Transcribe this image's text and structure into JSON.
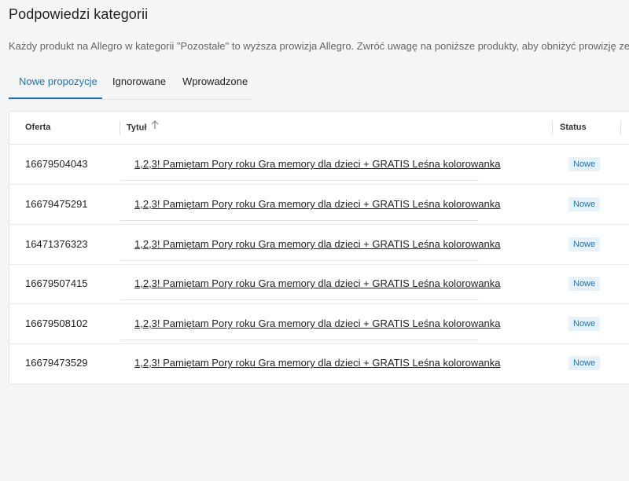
{
  "page": {
    "title": "Podpowiedzi kategorii",
    "description": "Każdy produkt na Allegro w kategorii \"Pozostałe\" to wyższa prowizja Allegro. Zwróć uwagę na poniższe produkty, aby obniżyć prowizję ze sprzedaży"
  },
  "tabs": [
    {
      "label": "Nowe propozycje",
      "active": true
    },
    {
      "label": "Ignorowane",
      "active": false
    },
    {
      "label": "Wprowadzone",
      "active": false
    }
  ],
  "table": {
    "headers": {
      "offer": "Oferta",
      "title": "Tytuł",
      "status": "Status"
    },
    "sort_icon": "arrow-up-icon",
    "rows": [
      {
        "offer": "16679504043",
        "title": "1,2,3! Pamiętam Pory roku Gra memory dla dzieci + GRATIS Leśna kolorowanka",
        "status": "Nowe"
      },
      {
        "offer": "16679475291",
        "title": "1,2,3! Pamiętam Pory roku Gra memory dla dzieci + GRATIS Leśna kolorowanka",
        "status": "Nowe"
      },
      {
        "offer": "16471376323",
        "title": "1,2,3! Pamiętam Pory roku Gra memory dla dzieci + GRATIS Leśna kolorowanka",
        "status": "Nowe"
      },
      {
        "offer": "16679507415",
        "title": "1,2,3! Pamiętam Pory roku Gra memory dla dzieci + GRATIS Leśna kolorowanka",
        "status": "Nowe"
      },
      {
        "offer": "16679508102",
        "title": "1,2,3! Pamiętam Pory roku Gra memory dla dzieci + GRATIS Leśna kolorowanka",
        "status": "Nowe"
      },
      {
        "offer": "16679473529",
        "title": "1,2,3! Pamiętam Pory roku Gra memory dla dzieci + GRATIS Leśna kolorowanka",
        "status": "Nowe"
      }
    ]
  },
  "colors": {
    "accent": "#1a73b8",
    "badge_bg": "#e6f1fa",
    "page_bg": "#f4f5f6"
  }
}
